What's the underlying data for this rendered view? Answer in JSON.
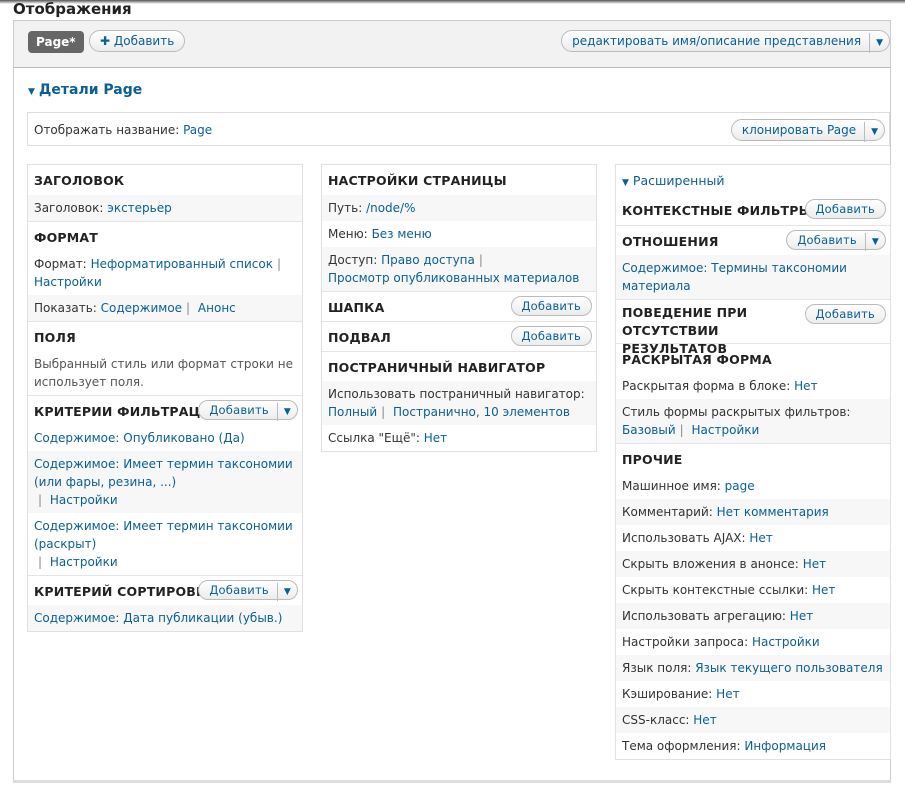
{
  "page": {
    "title": "Отображения"
  },
  "tabs": {
    "active": "Page*",
    "add_label": "Добавить",
    "edit_label": "редактировать имя/описание представления"
  },
  "details": {
    "title": "Детали Page",
    "display_name_label": "Отображать название:",
    "display_name_value": "Page",
    "clone_label": "клонировать Page"
  },
  "col1": {
    "title_sec": {
      "head": "ЗАГОЛОВОК",
      "label": "Заголовок:",
      "value": "экстерьер"
    },
    "format_sec": {
      "head": "ФОРМАТ",
      "format_label": "Формат:",
      "format_value": "Неформатированный список",
      "format_settings": "Настройки",
      "show_label": "Показать:",
      "show_value": "Содержимое",
      "show_mode": "Анонс"
    },
    "fields_sec": {
      "head": "ПОЛЯ",
      "text": "Выбранный стиль или формат строки не использует поля."
    },
    "filter_sec": {
      "head": "КРИТЕРИИ ФИЛЬТРАЦИИ",
      "add": "Добавить",
      "items": [
        {
          "text": "Содержимое: Опубликовано (Да)"
        },
        {
          "text": "Содержимое: Имеет термин таксономии (или фары, резина, ...)",
          "settings": "Настройки"
        },
        {
          "text": "Содержимое: Имеет термин таксономии (раскрыт)",
          "settings": "Настройки"
        }
      ]
    },
    "sort_sec": {
      "head": "КРИТЕРИЙ СОРТИРОВКИ",
      "add": "Добавить",
      "item": "Содержимое: Дата публикации (убыв.)"
    }
  },
  "col2": {
    "page_settings": {
      "head": "НАСТРОЙКИ СТРАНИЦЫ",
      "path_label": "Путь:",
      "path_value": "/node/%",
      "menu_label": "Меню:",
      "menu_value": "Без меню",
      "access_label": "Доступ:",
      "access_value": "Право доступа",
      "access_detail": "Просмотр опубликованных материалов"
    },
    "header_sec": {
      "head": "ШАПКА",
      "add": "Добавить"
    },
    "footer_sec": {
      "head": "ПОДВАЛ",
      "add": "Добавить"
    },
    "pager_sec": {
      "head": "ПОСТРАНИЧНЫЙ НАВИГАТОР",
      "use_label": "Использовать постраничный навигатор:",
      "use_value": "Полный",
      "use_detail": "Постранично, 10 элементов",
      "more_label": "Ссылка \"Ещё\":",
      "more_value": "Нет"
    }
  },
  "col3": {
    "advanced": "Расширенный",
    "context_sec": {
      "head": "КОНТЕКСТНЫЕ ФИЛЬТРЫ",
      "add": "Добавить"
    },
    "relations_sec": {
      "head": "ОТНОШЕНИЯ",
      "add": "Добавить",
      "item": "Содержимое: Термины таксономии материала"
    },
    "empty_sec": {
      "head": "ПОВЕДЕНИЕ ПРИ ОТСУТСТВИИ РЕЗУЛЬТАТОВ",
      "add": "Добавить"
    },
    "exposed_sec": {
      "head": "РАСКРЫТАЯ ФОРМА",
      "block_label": "Раскрытая форма в блоке:",
      "block_value": "Нет",
      "style_label": "Стиль формы раскрытых фильтров:",
      "style_value": "Базовый",
      "style_settings": "Настройки"
    },
    "other_sec": {
      "head": "ПРОЧИЕ",
      "rows": [
        {
          "label": "Машинное имя:",
          "value": "page"
        },
        {
          "label": "Комментарий:",
          "value": "Нет комментария"
        },
        {
          "label": "Использовать AJAX:",
          "value": "Нет"
        },
        {
          "label": "Скрыть вложения в анонсе:",
          "value": "Нет"
        },
        {
          "label": "Скрыть контекстные ссылки:",
          "value": "Нет"
        },
        {
          "label": "Использовать агрегацию:",
          "value": "Нет"
        },
        {
          "label": "Настройки запроса:",
          "value": "Настройки"
        },
        {
          "label": "Язык поля:",
          "value": "Язык текущего пользователя"
        },
        {
          "label": "Кэширование:",
          "value": "Нет"
        },
        {
          "label": "CSS-класс:",
          "value": "Нет"
        },
        {
          "label": "Тема оформления:",
          "value": "Информация"
        }
      ]
    }
  }
}
